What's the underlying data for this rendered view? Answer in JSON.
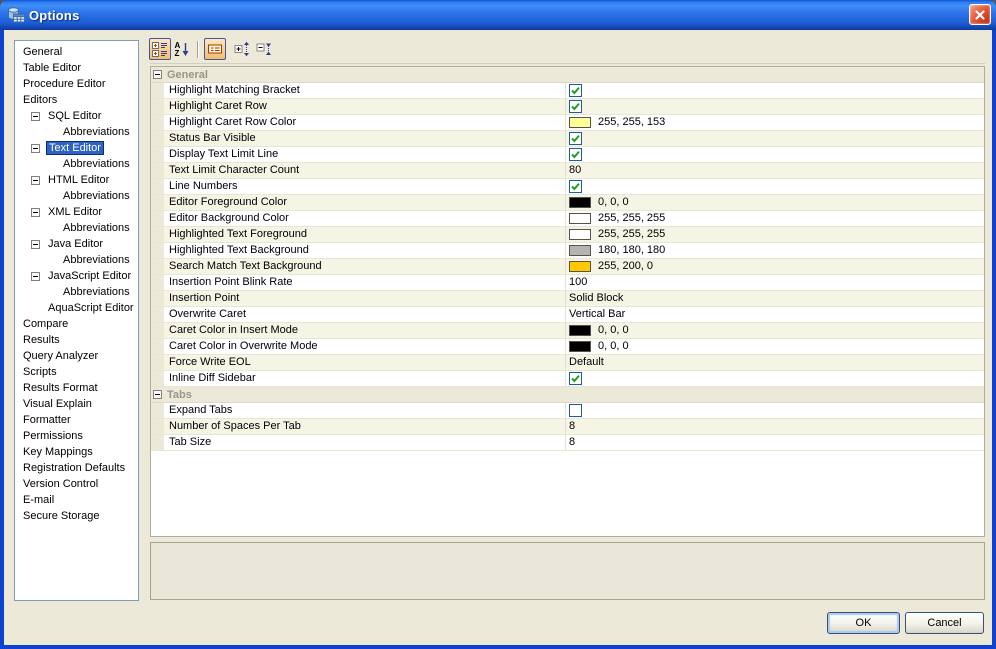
{
  "window": {
    "title": "Options"
  },
  "sidebar": {
    "items": [
      {
        "label": "General",
        "level": 0
      },
      {
        "label": "Table Editor",
        "level": 0
      },
      {
        "label": "Procedure Editor",
        "level": 0
      },
      {
        "label": "Editors",
        "level": 0
      },
      {
        "label": "SQL Editor",
        "level": 1,
        "expander": true
      },
      {
        "label": "Abbreviations",
        "level": 2
      },
      {
        "label": "Text Editor",
        "level": 1,
        "expander": true,
        "selected": true
      },
      {
        "label": "Abbreviations",
        "level": 2
      },
      {
        "label": "HTML Editor",
        "level": 1,
        "expander": true
      },
      {
        "label": "Abbreviations",
        "level": 2
      },
      {
        "label": "XML Editor",
        "level": 1,
        "expander": true
      },
      {
        "label": "Abbreviations",
        "level": 2
      },
      {
        "label": "Java Editor",
        "level": 1,
        "expander": true
      },
      {
        "label": "Abbreviations",
        "level": 2
      },
      {
        "label": "JavaScript Editor",
        "level": 1,
        "expander": true
      },
      {
        "label": "Abbreviations",
        "level": 2
      },
      {
        "label": "AquaScript Editor",
        "level": 1
      },
      {
        "label": "Compare",
        "level": 0
      },
      {
        "label": "Results",
        "level": 0
      },
      {
        "label": "Query Analyzer",
        "level": 0
      },
      {
        "label": "Scripts",
        "level": 0
      },
      {
        "label": "Results Format",
        "level": 0
      },
      {
        "label": "Visual Explain",
        "level": 0
      },
      {
        "label": "Formatter",
        "level": 0
      },
      {
        "label": "Permissions",
        "level": 0
      },
      {
        "label": "Key Mappings",
        "level": 0
      },
      {
        "label": "Registration Defaults",
        "level": 0
      },
      {
        "label": "Version Control",
        "level": 0
      },
      {
        "label": "E-mail",
        "level": 0
      },
      {
        "label": "Secure Storage",
        "level": 0
      }
    ]
  },
  "toolbar": {
    "az": {
      "a": "A",
      "z": "Z"
    },
    "buttons": [
      {
        "name": "categorized",
        "selected": true
      },
      {
        "name": "sort-alphabetical",
        "selected": false
      },
      {
        "name": "show-description",
        "selected": true
      },
      {
        "name": "expand-all",
        "selected": false
      },
      {
        "name": "collapse-all",
        "selected": false
      }
    ]
  },
  "property_grid": {
    "groups": [
      {
        "label": "General",
        "rows": [
          {
            "name": "Highlight Matching Bracket",
            "type": "checkbox",
            "checked": true
          },
          {
            "name": "Highlight Caret Row",
            "type": "checkbox",
            "checked": true
          },
          {
            "name": "Highlight Caret Row Color",
            "type": "color",
            "value": "255, 255, 153",
            "hex": "#ffff99"
          },
          {
            "name": "Status Bar Visible",
            "type": "checkbox",
            "checked": true
          },
          {
            "name": "Display Text Limit Line",
            "type": "checkbox",
            "checked": true
          },
          {
            "name": "Text Limit Character Count",
            "type": "text",
            "value": "80"
          },
          {
            "name": "Line Numbers",
            "type": "checkbox",
            "checked": true
          },
          {
            "name": "Editor Foreground Color",
            "type": "color",
            "value": "0, 0, 0",
            "hex": "#000000"
          },
          {
            "name": "Editor Background Color",
            "type": "color",
            "value": "255, 255, 255",
            "hex": "#ffffff"
          },
          {
            "name": "Highlighted Text Foreground",
            "type": "color",
            "value": "255, 255, 255",
            "hex": "#ffffff"
          },
          {
            "name": "Highlighted Text Background",
            "type": "color",
            "value": "180, 180, 180",
            "hex": "#b4b4b4"
          },
          {
            "name": "Search Match Text Background",
            "type": "color",
            "value": "255, 200, 0",
            "hex": "#ffc800"
          },
          {
            "name": "Insertion Point Blink Rate",
            "type": "text",
            "value": "100"
          },
          {
            "name": "Insertion Point",
            "type": "text",
            "value": "Solid Block"
          },
          {
            "name": "Overwrite Caret",
            "type": "text",
            "value": "Vertical Bar"
          },
          {
            "name": "Caret Color in Insert Mode",
            "type": "color",
            "value": "0, 0, 0",
            "hex": "#000000"
          },
          {
            "name": "Caret Color in Overwrite Mode",
            "type": "color",
            "value": "0, 0, 0",
            "hex": "#000000"
          },
          {
            "name": "Force Write EOL",
            "type": "text",
            "value": "Default"
          },
          {
            "name": "Inline Diff Sidebar",
            "type": "checkbox",
            "checked": true
          }
        ]
      },
      {
        "label": "Tabs",
        "rows": [
          {
            "name": "Expand Tabs",
            "type": "checkbox",
            "checked": false
          },
          {
            "name": "Number of Spaces Per Tab",
            "type": "text",
            "value": "8"
          },
          {
            "name": "Tab Size",
            "type": "text",
            "value": "8"
          }
        ]
      }
    ]
  },
  "buttons": {
    "ok_label": "OK",
    "cancel_label": "Cancel"
  },
  "colors": {
    "titlebar_blue": "#2d74ea",
    "window_border": "#0d43cf",
    "dialog_bg": "#ece9d8",
    "row_alt_bg": "#f6f4e5",
    "selection_bg": "#2e63c3",
    "group_header_text": "#98968b",
    "check_green": "#1fa11f",
    "close_red": "#d84628",
    "toolbar_selected_bg": "#f9cf8d"
  }
}
